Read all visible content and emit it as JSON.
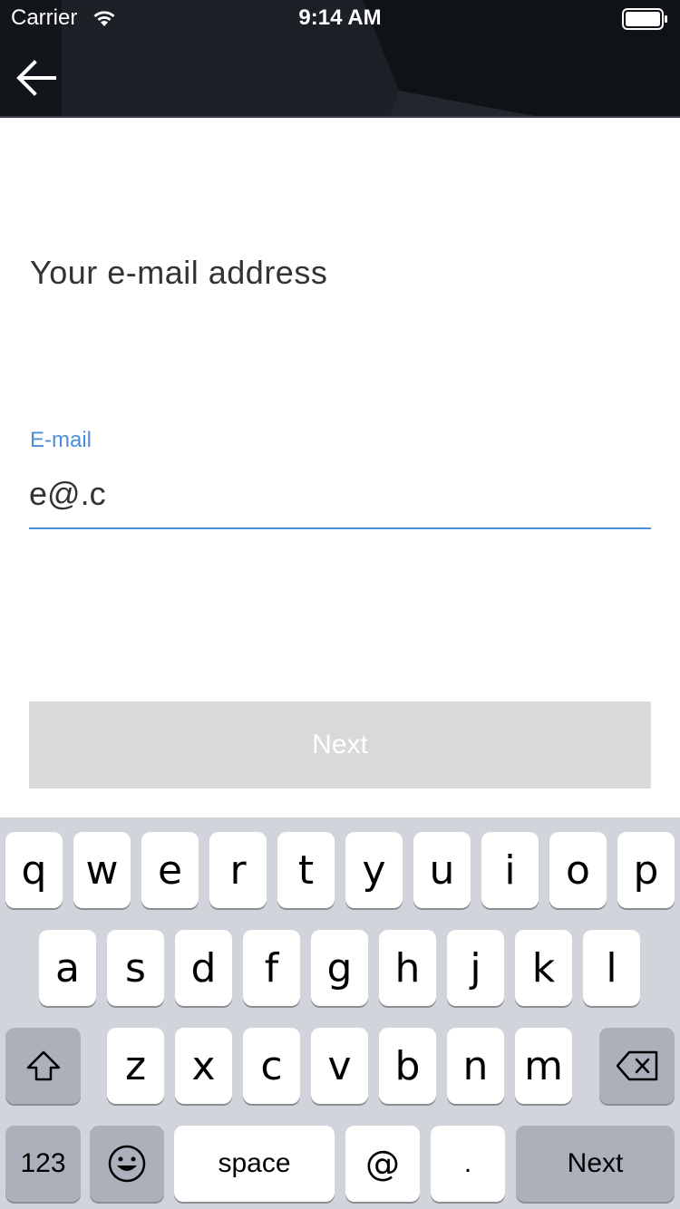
{
  "status_bar": {
    "carrier": "Carrier",
    "time": "9:14 AM",
    "wifi_icon": "wifi-icon",
    "battery_icon": "battery-icon"
  },
  "header": {
    "back_icon": "arrow-left-icon",
    "background_color": "#15191f"
  },
  "main": {
    "title": "Your e-mail address",
    "email_field": {
      "label": "E-mail",
      "value": "e@.c"
    },
    "next_button": "Next"
  },
  "colors": {
    "accent": "#4a8fd8",
    "button_disabled": "#d9d9d9",
    "keyboard_bg": "#d1d4da"
  },
  "keyboard": {
    "row1": [
      "q",
      "w",
      "e",
      "r",
      "t",
      "y",
      "u",
      "i",
      "o",
      "p"
    ],
    "row2": [
      "a",
      "s",
      "d",
      "f",
      "g",
      "h",
      "j",
      "k",
      "l"
    ],
    "row3": [
      "z",
      "x",
      "c",
      "v",
      "b",
      "n",
      "m"
    ],
    "shift_icon": "shift-icon",
    "delete_icon": "backspace-icon",
    "numbers": "123",
    "emoji_icon": "emoji-icon",
    "space": "space",
    "at": "@",
    "dot": ".",
    "return": "Next"
  }
}
